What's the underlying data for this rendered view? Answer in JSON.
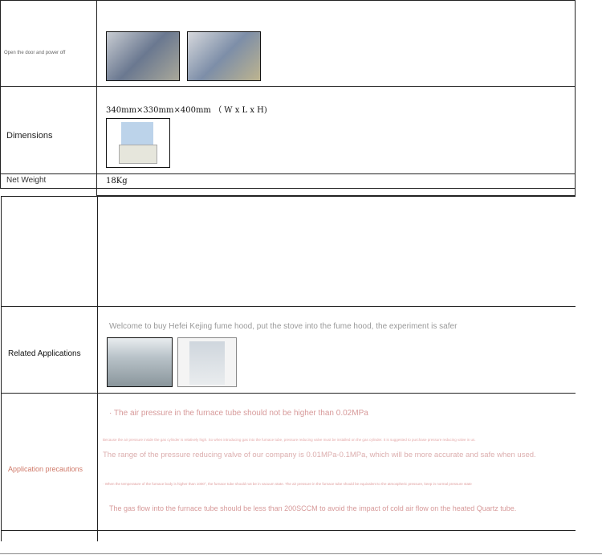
{
  "spec_table": {
    "rows": [
      {
        "label": "Open the door and power off",
        "value": ""
      },
      {
        "label": "Dimensions",
        "value": "340mm×330mm×400mm （ W x L x H)"
      },
      {
        "label": "Net Weight",
        "value": "18Kg"
      }
    ]
  },
  "info_table": {
    "rows": [
      {
        "label": "",
        "value": ""
      },
      {
        "label": "Related Applications",
        "value": "Welcome to buy Hefei Kejing fume hood, put the stove into the fume hood, the experiment is safer"
      },
      {
        "label": "Application precautions",
        "lines": [
          "· The air pressure in the furnace tube should not be higher than 0.02MPa",
          "Because the air pressure inside the gas cylinder is relatively high. So when introducing gas into the furnace tube, pressure reducing valve must be installed on the gas cylinder. It is suggested to purchase pressure reducing valve in us.",
          "The range of the pressure reducing valve of our company is 0.01MPa-0.1MPa, which will be more accurate and safe when used.",
          "· When the temperature of the furnace body is higher than 1000°, the furnace tube should not be in vacuum state. The air pressure in the furnace tube should be equivalent to the atmospheric pressure, keep in normal pressure state",
          "The gas flow into the furnace tube should be less than 200SCCM to avoid the impact of cold air flow on the heated Quartz tube."
        ]
      }
    ]
  },
  "colors": {
    "accent_text": "#d9a0a0",
    "border": "#222222"
  }
}
